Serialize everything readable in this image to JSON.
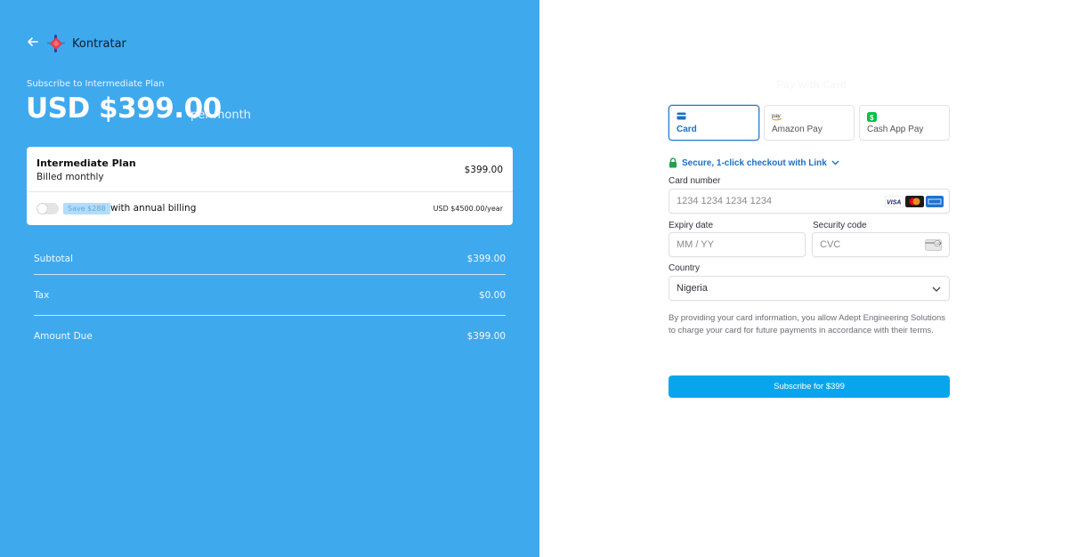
{
  "left": {
    "brand_name": "Kontratar",
    "subscribe_to": "Subscribe to Intermediate Plan",
    "price": "USD $399.00",
    "period": "per month",
    "plan": {
      "name": "Intermediate Plan",
      "billing": "Billed monthly",
      "price": "$399.00",
      "save_badge": "Save $288",
      "annual_label": "with annual billing",
      "annual_price": "USD $4500.00/year",
      "annual_toggle_on": false
    },
    "summary": {
      "subtotal_label": "Subtotal",
      "subtotal_value": "$399.00",
      "tax_label": "Tax",
      "tax_value": "$0.00",
      "amount_due_label": "Amount Due",
      "amount_due_value": "$399.00"
    },
    "background_color": "#3fa9ee"
  },
  "right": {
    "title": "Pay with Card",
    "methods": [
      {
        "label": "Card",
        "icon": "credit-card-icon",
        "selected": true
      },
      {
        "label": "Amazon Pay",
        "icon": "amazon-pay-icon",
        "selected": false
      },
      {
        "label": "Cash App Pay",
        "icon": "cash-app-icon",
        "selected": false
      }
    ],
    "link_text": "Secure, 1-click checkout with Link",
    "card_number": {
      "label": "Card number",
      "placeholder": "1234 1234 1234 1234",
      "brands": [
        "visa-icon",
        "mastercard-icon",
        "amex-icon"
      ]
    },
    "expiry": {
      "label": "Expiry date",
      "placeholder": "MM / YY"
    },
    "security": {
      "label": "Security code",
      "placeholder": "CVC",
      "icon": "cvc-card-icon"
    },
    "country": {
      "label": "Country",
      "value": "Nigeria"
    },
    "consent": "By providing your card information, you allow Adept Engineering Solutions to charge your card for future payments in accordance with their terms.",
    "submit_label": "Subscribe for $399",
    "accent_color": "#07a6ec"
  }
}
